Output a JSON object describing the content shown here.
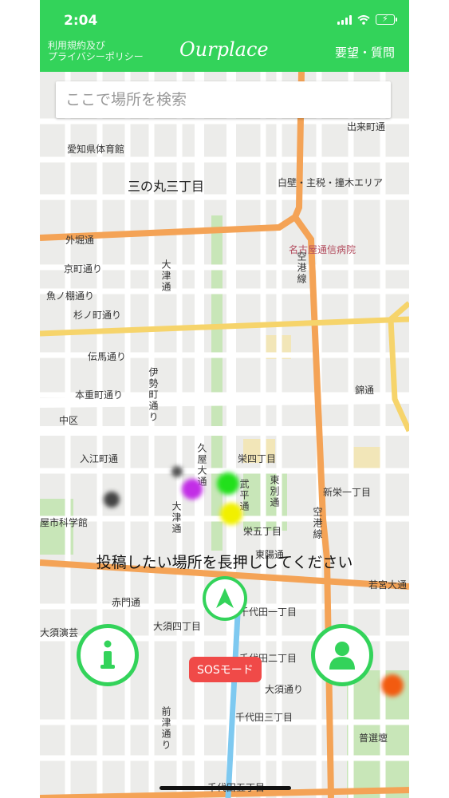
{
  "status_bar": {
    "time": "2:04"
  },
  "header": {
    "terms_line1": "利用規約及び",
    "terms_line2": "プライバシーポリシー",
    "brand": "Ourplace",
    "request_link": "要望・質問"
  },
  "search": {
    "placeholder": "ここで場所を検索"
  },
  "map": {
    "labels": {
      "gym": "愛知県体育館",
      "sannomaru": "三の丸三丁目",
      "demachi": "出来町通",
      "tax_area": "白壁・主税・撞木エリア",
      "sotobori": "外堀通",
      "hospital": "名古屋通信病院",
      "kuko1": "空港線",
      "kyomachi": "京町通り",
      "uonotana": "魚ノ棚通り",
      "suginomachi": "杉ノ町通り",
      "otsu1": "大津通",
      "denma": "伝馬通り",
      "honjuya": "本重町通り",
      "ise": "伊勢町通り",
      "naka": "中区",
      "nishiki": "錦通",
      "irie": "入江町通",
      "hisaya": "久屋大通",
      "sakae4": "栄四丁目",
      "takehira": "武平通",
      "higashibetsu": "東別通",
      "shinsakae": "新栄一丁目",
      "museum": "屋市科学館",
      "otsu2": "大津通",
      "sakae5": "栄五丁目",
      "kuko2": "空港線",
      "higashidoori": "東陽通",
      "wakamiya": "若宮大通",
      "akamon": "赤門通",
      "osu4": "大須四丁目",
      "chiyoda1": "千代田一丁目",
      "osuen": "大須演芸",
      "chiyoda2": "千代田二丁目",
      "osudori": "大須通り",
      "chiyoda3": "千代田三丁目",
      "maetsu": "前津通り",
      "fujimi": "普選壇",
      "chiyoda5": "千代田五丁目"
    }
  },
  "instruction": "投稿したい場所を長押ししてください",
  "buttons": {
    "sos": "SOSモード"
  },
  "colors": {
    "brand_green": "#33d35a",
    "sos_red": "#f04a48",
    "dot_green": "#22e01c",
    "dot_yellow": "#f1f000",
    "dot_magenta": "#c22ee6",
    "dot_gray": "#444444",
    "dot_orange": "#f25b10"
  }
}
